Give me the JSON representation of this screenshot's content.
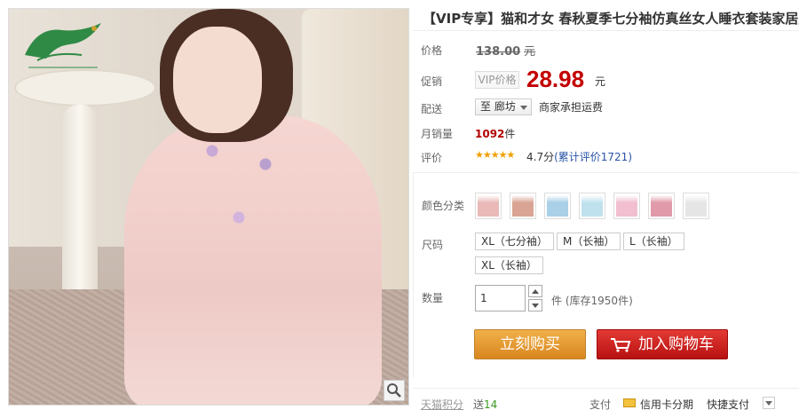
{
  "product": {
    "title": "【VIP专享】猫和才女 春秋夏季七分袖仿真丝女人睡衣套装家居服"
  },
  "price": {
    "label": "价格",
    "original": "138.00",
    "currency": "元"
  },
  "promo": {
    "label": "促销",
    "vip_tag": "VIP价格",
    "price": "28.98",
    "currency": "元"
  },
  "delivery": {
    "label": "配送",
    "location_prefix": "至",
    "location": "廊坊",
    "note": "商家承担运费"
  },
  "sales": {
    "label": "月销量",
    "count": "1092",
    "unit": "件"
  },
  "rating": {
    "label": "评价",
    "stars": "★★★★★",
    "score": "4.7分",
    "cumulative": "(累计评价1721)"
  },
  "color": {
    "label": "颜色分类",
    "swatches": [
      {
        "name": "pink-sleepwear",
        "color": "#e9b9b8"
      },
      {
        "name": "pink-top-shorts",
        "color": "#d9a493"
      },
      {
        "name": "blue-set",
        "color": "#a9d0e6"
      },
      {
        "name": "light-blue-set",
        "color": "#bfe1ee"
      },
      {
        "name": "pink-stripe-set",
        "color": "#f1bfcf"
      },
      {
        "name": "rose-set",
        "color": "#e19aaa"
      },
      {
        "name": "white-set",
        "color": "#e5e5e5"
      }
    ]
  },
  "size": {
    "label": "尺码",
    "options": [
      "XL（七分袖）",
      "M（长袖）",
      "L（长袖）",
      "XL（长袖）"
    ]
  },
  "quantity": {
    "label": "数量",
    "value": "1",
    "unit": "件",
    "stock": "(库存1950件)"
  },
  "actions": {
    "buy_now": "立刻购买",
    "add_to_cart": "加入购物车"
  },
  "footer": {
    "points_label": "天猫积分",
    "points_prefix": "送",
    "points_value": "14",
    "pay_label": "支付",
    "credit_card": "信用卡分期",
    "quick_pay": "快捷支付"
  }
}
